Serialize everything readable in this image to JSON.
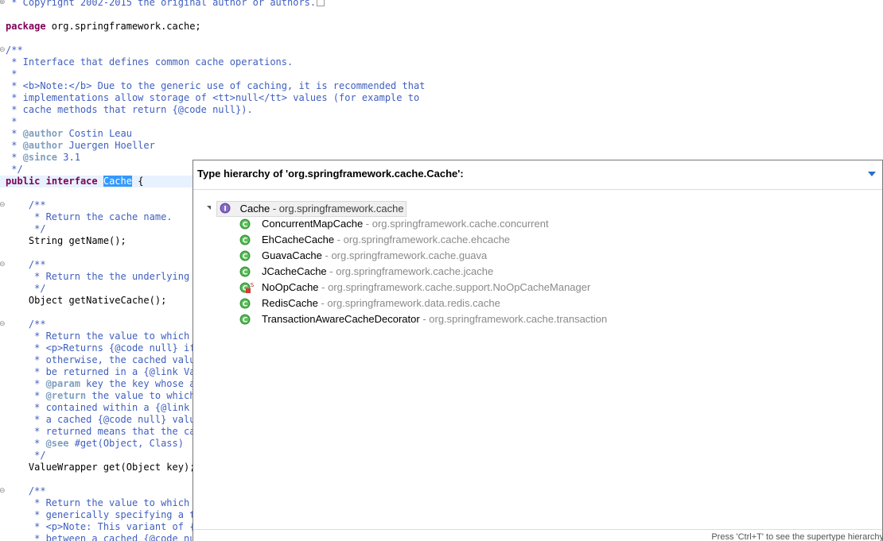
{
  "editor": {
    "lines": {
      "l1": " * Copyright 2002-2015 the original author or authors.",
      "l3_kw": "package",
      "l3_rest": " org.springframework.cache;",
      "l5": "/**",
      "l6": " * Interface that defines common cache operations.",
      "l7": " *",
      "l8": " * <b>Note:</b> Due to the generic use of caching, it is recommended that",
      "l9": " * implementations allow storage of <tt>null</tt> values (for example to",
      "l10": " * cache methods that return {@code null}).",
      "l11": " *",
      "l12_pre": " * ",
      "l12_tag": "@author",
      "l12_rest": " Costin Leau",
      "l13_pre": " * ",
      "l13_tag": "@author",
      "l13_rest": " Juergen Hoeller",
      "l14_pre": " * ",
      "l14_tag": "@since",
      "l14_rest": " 3.1",
      "l15": " */",
      "l16_kw1": "public",
      "l16_kw2": "interface",
      "l16_sel": "Cache",
      "l16_rest": " {",
      "l18": "    /**",
      "l19": "     * Return the cache name.",
      "l20": "     */",
      "l21": "    String getName();",
      "l23": "    /**",
      "l24": "     * Return the the underlying n",
      "l25": "     */",
      "l26": "    Object getNativeCache();",
      "l28": "    /**",
      "l29": "     * Return the value to which t",
      "l30": "     * <p>Returns {@code null} if",
      "l31": "     * otherwise, the cached value",
      "l32": "     * be returned in a {@link Val",
      "l33_pre": "     * ",
      "l33_tag": "@param",
      "l33_rest": " key the key whose as",
      "l34_pre": "     * ",
      "l34_tag": "@return",
      "l34_rest": " the value to which",
      "l35": "     * contained within a {@link V",
      "l36": "     * a cached {@code null} value",
      "l37": "     * returned means that the cac",
      "l38_pre": "     * ",
      "l38_tag": "@see",
      "l38_rest": " #get(Object, Class)",
      "l39": "     */",
      "l40": "    ValueWrapper get(Object key);",
      "l42": "    /**",
      "l43": "     * Return the value to which t",
      "l44": "     * generically specifying a ty",
      "l45": "     * <p>Note: This variant of {@",
      "l46": "     * between a cached {@code nu"
    }
  },
  "popup": {
    "title": "Type hierarchy of 'org.springframework.cache.Cache':",
    "footer": "Press 'Ctrl+T' to see the supertype hierarchy",
    "root": {
      "name": "Cache",
      "package": " - org.springframework.cache"
    },
    "children": [
      {
        "name": "ConcurrentMapCache",
        "package": " - org.springframework.cache.concurrent"
      },
      {
        "name": "EhCacheCache",
        "package": " - org.springframework.cache.ehcache"
      },
      {
        "name": "GuavaCache",
        "package": " - org.springframework.cache.guava"
      },
      {
        "name": "JCacheCache",
        "package": " - org.springframework.cache.jcache"
      },
      {
        "name": "NoOpCache",
        "package": " - org.springframework.cache.support.NoOpCacheManager"
      },
      {
        "name": "RedisCache",
        "package": " - org.springframework.data.redis.cache"
      },
      {
        "name": "TransactionAwareCacheDecorator",
        "package": " - org.springframework.cache.transaction"
      }
    ]
  },
  "colors": {
    "keyword": "#7f0055",
    "comment": "#3f5fbf",
    "selection": "#3399ff",
    "class_icon": "#3c9a3c",
    "interface_icon": "#6a4ca8"
  }
}
